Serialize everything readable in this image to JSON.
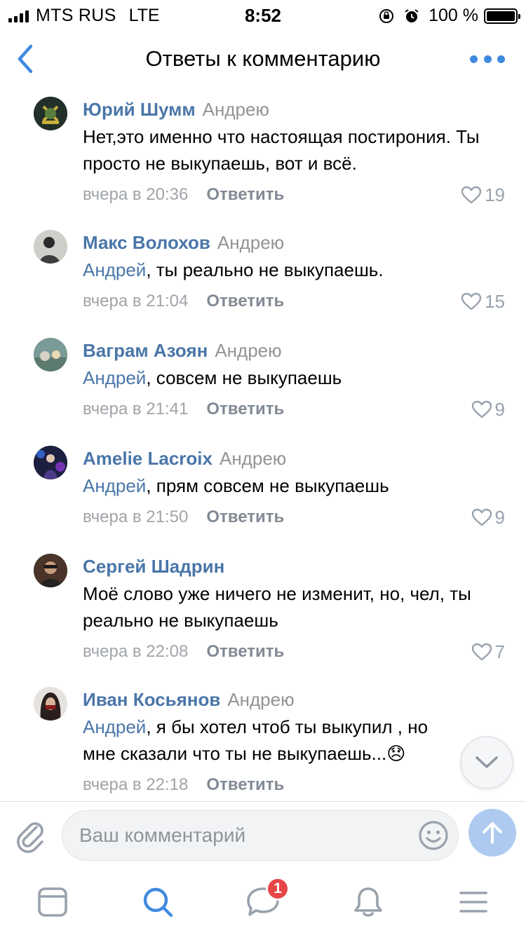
{
  "status_bar": {
    "carrier": "MTS RUS",
    "network": "LTE",
    "time": "8:52",
    "battery": "100 %"
  },
  "header": {
    "title": "Ответы к комментарию"
  },
  "comments": [
    {
      "author": "Юрий Шумм",
      "reply_to": "Андрею",
      "mention": "",
      "text": "Нет,это именно что настоящая постирония. Ты просто не выкупаешь, вот и всё.",
      "time": "вчера в 20:36",
      "reply_label": "Ответить",
      "likes": "19"
    },
    {
      "author": "Макс Волохов",
      "reply_to": "Андрею",
      "mention": "Андрей",
      "text": ", ты реально не выкупаешь.",
      "time": "вчера в 21:04",
      "reply_label": "Ответить",
      "likes": "15"
    },
    {
      "author": "Ваграм Азоян",
      "reply_to": "Андрею",
      "mention": "Андрей",
      "text": ", совсем не выкупаешь",
      "time": "вчера в 21:41",
      "reply_label": "Ответить",
      "likes": "9"
    },
    {
      "author": "Amelie Lacroix",
      "reply_to": "Андрею",
      "mention": "Андрей",
      "text": ", прям совсем не выкупаешь",
      "time": "вчера в 21:50",
      "reply_label": "Ответить",
      "likes": "9"
    },
    {
      "author": "Сергей Шадрин",
      "reply_to": "",
      "mention": "",
      "text": "Моё слово уже ничего не изменит, но, чел, ты реально не выкупаешь",
      "time": "вчера в 22:08",
      "reply_label": "Ответить",
      "likes": "7"
    },
    {
      "author": "Иван Косьянов",
      "reply_to": "Андрею",
      "mention": "Андрей",
      "text": ", я бы хотел чтоб ты выкупил , но мне сказали что ты не выкупаешь...😞",
      "time": "вчера в 22:18",
      "reply_label": "Ответить",
      "likes": ""
    }
  ],
  "composer": {
    "placeholder": "Ваш комментарий"
  },
  "tab_bar": {
    "notifications_badge": "1",
    "tabs": [
      "newsfeed-icon",
      "search-icon",
      "messages-icon",
      "notifications-icon",
      "menu-icon"
    ]
  },
  "colors": {
    "accent": "#4a76a8",
    "link_blue": "#3f8ae0",
    "badge_red": "#e64646",
    "secondary_text": "#939393"
  }
}
